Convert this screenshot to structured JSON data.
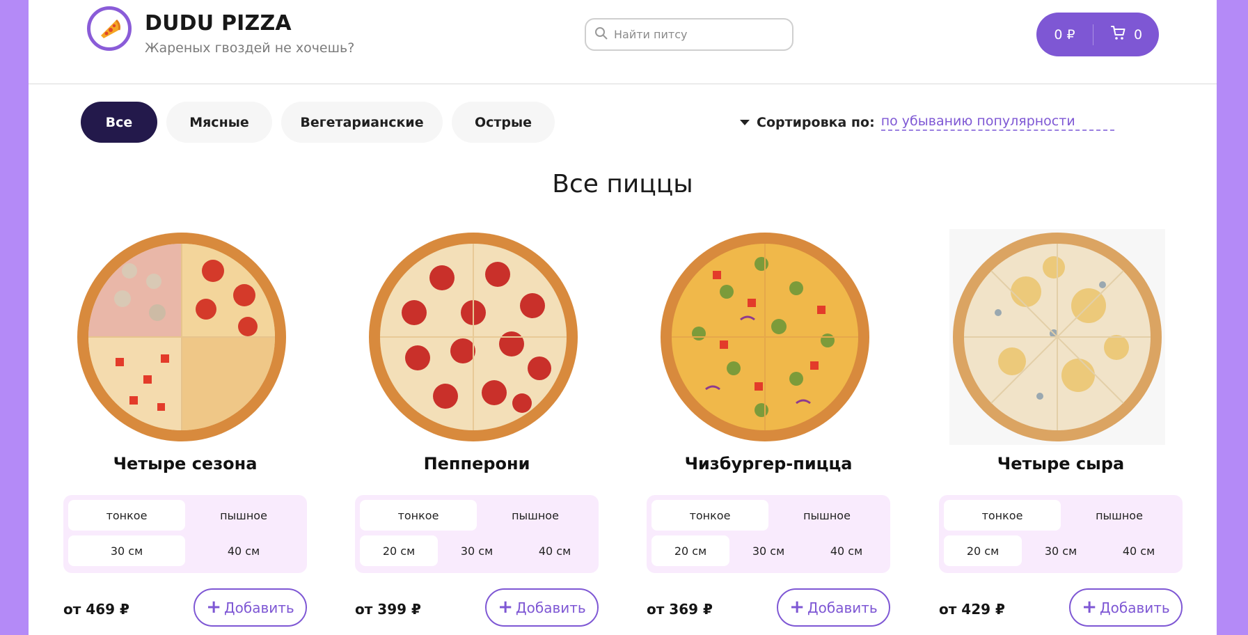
{
  "brand": {
    "title": "DUDU PIZZA",
    "subtitle": "Жареных гвоздей не хочешь?"
  },
  "search": {
    "placeholder": "Найти питсу",
    "value": ""
  },
  "cart": {
    "total": "0 ₽",
    "count": "0"
  },
  "categories": [
    {
      "label": "Все",
      "active": true
    },
    {
      "label": "Мясные",
      "active": false
    },
    {
      "label": "Вегетарианские",
      "active": false
    },
    {
      "label": "Острые",
      "active": false
    }
  ],
  "sort": {
    "label": "Сортировка по:",
    "value": "по убыванию популярности"
  },
  "section_title": "Все пиццы",
  "pizzas": [
    {
      "name": "Четыре сезона",
      "types": [
        "тонкое",
        "пышное"
      ],
      "sizes": [
        "30 см",
        "40 см"
      ],
      "price": "от 469 ₽",
      "add_label": "Добавить"
    },
    {
      "name": "Пепперони",
      "types": [
        "тонкое",
        "пышное"
      ],
      "sizes": [
        "20 см",
        "30 см",
        "40 см"
      ],
      "price": "от 399 ₽",
      "add_label": "Добавить"
    },
    {
      "name": "Чизбургер-пицца",
      "types": [
        "тонкое",
        "пышное"
      ],
      "sizes": [
        "20 см",
        "30 см",
        "40 см"
      ],
      "price": "от 369 ₽",
      "add_label": "Добавить"
    },
    {
      "name": "Четыре сыра",
      "types": [
        "тонкое",
        "пышное"
      ],
      "sizes": [
        "20 см",
        "30 см",
        "40 см"
      ],
      "price": "от 429 ₽",
      "add_label": "Добавить"
    }
  ],
  "colors": {
    "accent": "#7e57d4",
    "page_bg": "#b48af7",
    "active_category": "#23194b",
    "options_bg": "#f9ebfd"
  }
}
